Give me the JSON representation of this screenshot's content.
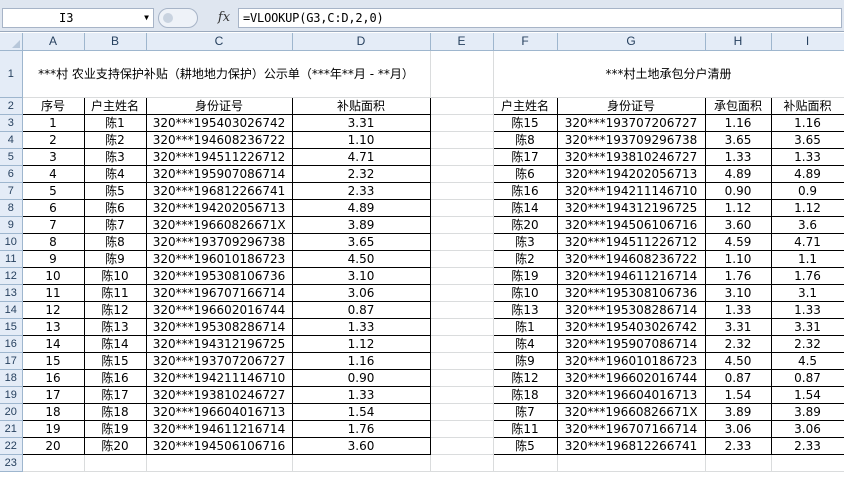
{
  "formula_bar": {
    "cell_ref": "I3",
    "fx": "fx",
    "formula": "=VLOOKUP(G3,C:D,2,0)"
  },
  "columns": [
    "A",
    "B",
    "C",
    "D",
    "E",
    "F",
    "G",
    "H",
    "I"
  ],
  "left_title": "***村 农业支持保护补贴（耕地地力保护）公示单（***年**月 - **月）",
  "right_title": "***村土地承包分户清册",
  "left_headers": [
    "序号",
    "户主姓名",
    "身份证号",
    "补贴面积"
  ],
  "right_headers": [
    "户主姓名",
    "身份证号",
    "承包面积",
    "补贴面积"
  ],
  "left_rows": [
    [
      "1",
      "陈1",
      "320***195403026742",
      "3.31"
    ],
    [
      "2",
      "陈2",
      "320***194608236722",
      "1.10"
    ],
    [
      "3",
      "陈3",
      "320***194511226712",
      "4.71"
    ],
    [
      "4",
      "陈4",
      "320***195907086714",
      "2.32"
    ],
    [
      "5",
      "陈5",
      "320***196812266741",
      "2.33"
    ],
    [
      "6",
      "陈6",
      "320***194202056713",
      "4.89"
    ],
    [
      "7",
      "陈7",
      "320***19660826671X",
      "3.89"
    ],
    [
      "8",
      "陈8",
      "320***193709296738",
      "3.65"
    ],
    [
      "9",
      "陈9",
      "320***196010186723",
      "4.50"
    ],
    [
      "10",
      "陈10",
      "320***195308106736",
      "3.10"
    ],
    [
      "11",
      "陈11",
      "320***196707166714",
      "3.06"
    ],
    [
      "12",
      "陈12",
      "320***196602016744",
      "0.87"
    ],
    [
      "13",
      "陈13",
      "320***195308286714",
      "1.33"
    ],
    [
      "14",
      "陈14",
      "320***194312196725",
      "1.12"
    ],
    [
      "15",
      "陈15",
      "320***193707206727",
      "1.16"
    ],
    [
      "16",
      "陈16",
      "320***194211146710",
      "0.90"
    ],
    [
      "17",
      "陈17",
      "320***193810246727",
      "1.33"
    ],
    [
      "18",
      "陈18",
      "320***196604016713",
      "1.54"
    ],
    [
      "19",
      "陈19",
      "320***194611216714",
      "1.76"
    ],
    [
      "20",
      "陈20",
      "320***194506106716",
      "3.60"
    ]
  ],
  "right_rows": [
    [
      "陈15",
      "320***193707206727",
      "1.16",
      "1.16"
    ],
    [
      "陈8",
      "320***193709296738",
      "3.65",
      "3.65"
    ],
    [
      "陈17",
      "320***193810246727",
      "1.33",
      "1.33"
    ],
    [
      "陈6",
      "320***194202056713",
      "4.89",
      "4.89"
    ],
    [
      "陈16",
      "320***194211146710",
      "0.90",
      "0.9"
    ],
    [
      "陈14",
      "320***194312196725",
      "1.12",
      "1.12"
    ],
    [
      "陈20",
      "320***194506106716",
      "3.60",
      "3.6"
    ],
    [
      "陈3",
      "320***194511226712",
      "4.59",
      "4.71"
    ],
    [
      "陈2",
      "320***194608236722",
      "1.10",
      "1.1"
    ],
    [
      "陈19",
      "320***194611216714",
      "1.76",
      "1.76"
    ],
    [
      "陈10",
      "320***195308106736",
      "3.10",
      "3.1"
    ],
    [
      "陈13",
      "320***195308286714",
      "1.33",
      "1.33"
    ],
    [
      "陈1",
      "320***195403026742",
      "3.31",
      "3.31"
    ],
    [
      "陈4",
      "320***195907086714",
      "2.32",
      "2.32"
    ],
    [
      "陈9",
      "320***196010186723",
      "4.50",
      "4.5"
    ],
    [
      "陈12",
      "320***196602016744",
      "0.87",
      "0.87"
    ],
    [
      "陈18",
      "320***196604016713",
      "1.54",
      "1.54"
    ],
    [
      "陈7",
      "320***19660826671X",
      "3.89",
      "3.89"
    ],
    [
      "陈11",
      "320***196707166714",
      "3.06",
      "3.06"
    ],
    [
      "陈5",
      "320***196812266741",
      "2.33",
      "2.33"
    ]
  ]
}
